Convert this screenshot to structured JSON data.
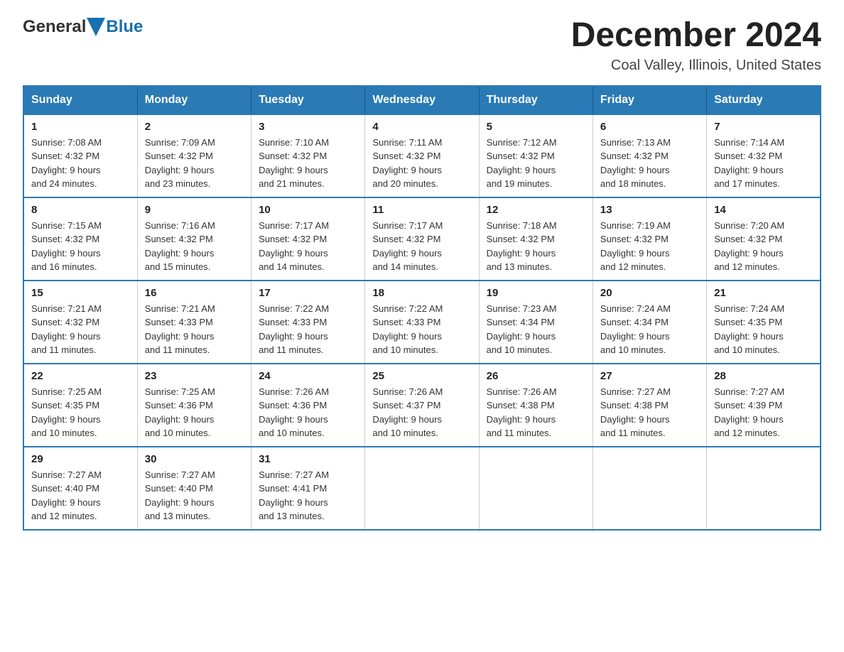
{
  "logo": {
    "text_general": "General",
    "text_blue": "Blue"
  },
  "header": {
    "month": "December 2024",
    "location": "Coal Valley, Illinois, United States"
  },
  "weekdays": [
    "Sunday",
    "Monday",
    "Tuesday",
    "Wednesday",
    "Thursday",
    "Friday",
    "Saturday"
  ],
  "weeks": [
    [
      {
        "day": "1",
        "sunrise": "7:08 AM",
        "sunset": "4:32 PM",
        "daylight": "9 hours and 24 minutes."
      },
      {
        "day": "2",
        "sunrise": "7:09 AM",
        "sunset": "4:32 PM",
        "daylight": "9 hours and 23 minutes."
      },
      {
        "day": "3",
        "sunrise": "7:10 AM",
        "sunset": "4:32 PM",
        "daylight": "9 hours and 21 minutes."
      },
      {
        "day": "4",
        "sunrise": "7:11 AM",
        "sunset": "4:32 PM",
        "daylight": "9 hours and 20 minutes."
      },
      {
        "day": "5",
        "sunrise": "7:12 AM",
        "sunset": "4:32 PM",
        "daylight": "9 hours and 19 minutes."
      },
      {
        "day": "6",
        "sunrise": "7:13 AM",
        "sunset": "4:32 PM",
        "daylight": "9 hours and 18 minutes."
      },
      {
        "day": "7",
        "sunrise": "7:14 AM",
        "sunset": "4:32 PM",
        "daylight": "9 hours and 17 minutes."
      }
    ],
    [
      {
        "day": "8",
        "sunrise": "7:15 AM",
        "sunset": "4:32 PM",
        "daylight": "9 hours and 16 minutes."
      },
      {
        "day": "9",
        "sunrise": "7:16 AM",
        "sunset": "4:32 PM",
        "daylight": "9 hours and 15 minutes."
      },
      {
        "day": "10",
        "sunrise": "7:17 AM",
        "sunset": "4:32 PM",
        "daylight": "9 hours and 14 minutes."
      },
      {
        "day": "11",
        "sunrise": "7:17 AM",
        "sunset": "4:32 PM",
        "daylight": "9 hours and 14 minutes."
      },
      {
        "day": "12",
        "sunrise": "7:18 AM",
        "sunset": "4:32 PM",
        "daylight": "9 hours and 13 minutes."
      },
      {
        "day": "13",
        "sunrise": "7:19 AM",
        "sunset": "4:32 PM",
        "daylight": "9 hours and 12 minutes."
      },
      {
        "day": "14",
        "sunrise": "7:20 AM",
        "sunset": "4:32 PM",
        "daylight": "9 hours and 12 minutes."
      }
    ],
    [
      {
        "day": "15",
        "sunrise": "7:21 AM",
        "sunset": "4:32 PM",
        "daylight": "9 hours and 11 minutes."
      },
      {
        "day": "16",
        "sunrise": "7:21 AM",
        "sunset": "4:33 PM",
        "daylight": "9 hours and 11 minutes."
      },
      {
        "day": "17",
        "sunrise": "7:22 AM",
        "sunset": "4:33 PM",
        "daylight": "9 hours and 11 minutes."
      },
      {
        "day": "18",
        "sunrise": "7:22 AM",
        "sunset": "4:33 PM",
        "daylight": "9 hours and 10 minutes."
      },
      {
        "day": "19",
        "sunrise": "7:23 AM",
        "sunset": "4:34 PM",
        "daylight": "9 hours and 10 minutes."
      },
      {
        "day": "20",
        "sunrise": "7:24 AM",
        "sunset": "4:34 PM",
        "daylight": "9 hours and 10 minutes."
      },
      {
        "day": "21",
        "sunrise": "7:24 AM",
        "sunset": "4:35 PM",
        "daylight": "9 hours and 10 minutes."
      }
    ],
    [
      {
        "day": "22",
        "sunrise": "7:25 AM",
        "sunset": "4:35 PM",
        "daylight": "9 hours and 10 minutes."
      },
      {
        "day": "23",
        "sunrise": "7:25 AM",
        "sunset": "4:36 PM",
        "daylight": "9 hours and 10 minutes."
      },
      {
        "day": "24",
        "sunrise": "7:26 AM",
        "sunset": "4:36 PM",
        "daylight": "9 hours and 10 minutes."
      },
      {
        "day": "25",
        "sunrise": "7:26 AM",
        "sunset": "4:37 PM",
        "daylight": "9 hours and 10 minutes."
      },
      {
        "day": "26",
        "sunrise": "7:26 AM",
        "sunset": "4:38 PM",
        "daylight": "9 hours and 11 minutes."
      },
      {
        "day": "27",
        "sunrise": "7:27 AM",
        "sunset": "4:38 PM",
        "daylight": "9 hours and 11 minutes."
      },
      {
        "day": "28",
        "sunrise": "7:27 AM",
        "sunset": "4:39 PM",
        "daylight": "9 hours and 12 minutes."
      }
    ],
    [
      {
        "day": "29",
        "sunrise": "7:27 AM",
        "sunset": "4:40 PM",
        "daylight": "9 hours and 12 minutes."
      },
      {
        "day": "30",
        "sunrise": "7:27 AM",
        "sunset": "4:40 PM",
        "daylight": "9 hours and 13 minutes."
      },
      {
        "day": "31",
        "sunrise": "7:27 AM",
        "sunset": "4:41 PM",
        "daylight": "9 hours and 13 minutes."
      },
      null,
      null,
      null,
      null
    ]
  ],
  "labels": {
    "sunrise": "Sunrise:",
    "sunset": "Sunset:",
    "daylight": "Daylight:"
  }
}
